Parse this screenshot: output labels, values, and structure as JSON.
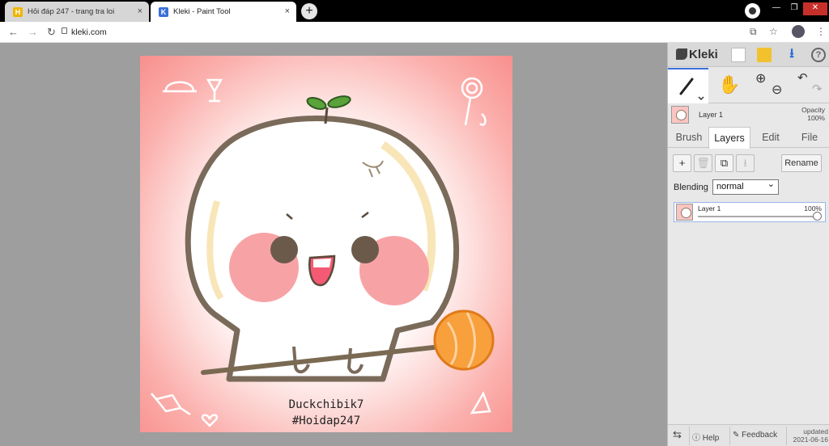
{
  "browser": {
    "tabs": [
      {
        "title": "Hỏi đáp 247 - trang tra loi",
        "favicon": "H"
      },
      {
        "title": "Kleki - Paint Tool",
        "favicon": "K"
      }
    ],
    "url": "kleki.com",
    "new_tab": "+",
    "close": "×",
    "win_min": "—",
    "win_restore": "❐",
    "win_close": "✕"
  },
  "canvas": {
    "credit_line1": "Duckchibik7",
    "credit_line2": "#Hoidap247"
  },
  "panel": {
    "logo": "Kleki",
    "layer_name": "Layer 1",
    "opacity_label": "Opacity",
    "opacity_value": "100%",
    "tabs": [
      "Brush",
      "Layers",
      "Edit",
      "File"
    ],
    "active_tab": "Layers",
    "rename": "Rename",
    "blending_label": "Blending",
    "blending_value": "normal",
    "layer_card": {
      "name": "Layer 1",
      "opacity": "100%",
      "opacity_fraction": 1.0
    },
    "help": "Help",
    "feedback": "Feedback",
    "updated_label": "updated",
    "updated_date": "2021-06-16"
  },
  "colors": {
    "accent": "#3a6fd8",
    "canvas_edge": "#f88f8d",
    "cheek": "#f7a3a6",
    "outline": "#7a6a5a",
    "lollipop": "#f7a03c"
  }
}
